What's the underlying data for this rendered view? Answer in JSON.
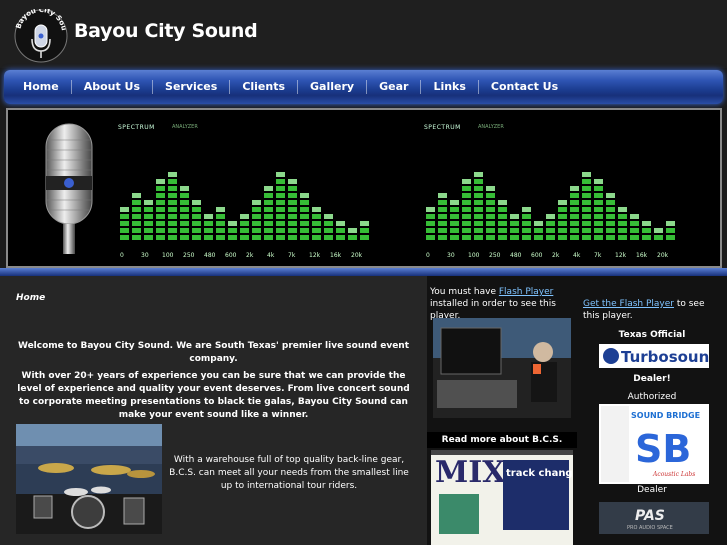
{
  "header": {
    "logo_text": "Bayou City Sound",
    "site_title": "Bayou City Sound"
  },
  "nav": {
    "items": [
      "Home",
      "About Us",
      "Services",
      "Clients",
      "Gallery",
      "Gear",
      "Links",
      "Contact Us"
    ]
  },
  "banner": {
    "spectrum_label": "SPECTRUM",
    "spectrum_sub": "ANALYZER",
    "frequency_ticks": [
      "0",
      "30",
      "100",
      "250",
      "480",
      "600",
      "2k",
      "4k",
      "7k",
      "12k",
      "16k",
      "20k"
    ]
  },
  "main": {
    "page_title": "Home",
    "welcome": "Welcome to Bayou City Sound. We are South Texas' premier live sound event company.",
    "experience": "With over 20+ years of experience you can be sure that we can provide the level of experience and quality your event deserves.  From live concert sound to corporate meeting presentations to black tie galas, Bayou City Sound can make your event sound like a winner.",
    "warehouse": "With a warehouse full of top quality back-line gear, B.C.S. can meet all your needs from the smallest line up to international tour riders."
  },
  "col2": {
    "flash_prefix": "You must have ",
    "flash_link": "Flash Player",
    "flash_suffix": " installed in order to see this player.",
    "read_more": "Read more about B.C.S.",
    "mag_title": "MIX",
    "mag_headline": "track changes"
  },
  "col3": {
    "flash_link": "Get the Flash Player",
    "flash_suffix": " to see this player.",
    "texas_official": "Texas Official",
    "turbosound": "Turbosound",
    "dealer": "Dealer!",
    "authorized": "Authorized",
    "sound_bridge": "SOUND BRIDGE",
    "acoustic_labs": "Acoustic Labs",
    "dealer2": "Dealer",
    "pas": "PAS",
    "pas_sub": "PRO AUDIO SPACE"
  },
  "colors": {
    "nav_blue": "#2f55b4",
    "spectrum_green": "#3cd23c",
    "link": "#7fc3ff"
  }
}
